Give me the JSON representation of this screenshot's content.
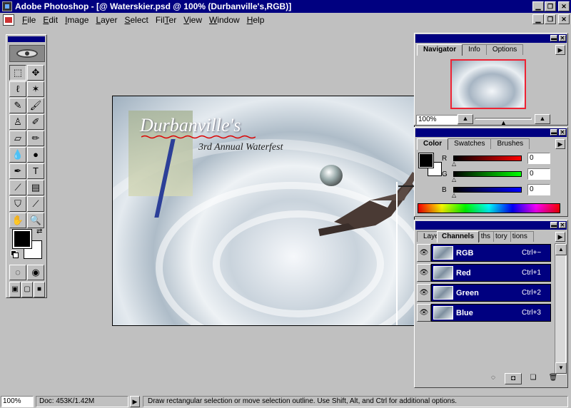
{
  "window": {
    "title": "Adobe Photoshop - [@ Waterskier.psd @ 100% (Durbanville's,RGB)]",
    "min_label": "▁",
    "max_label": "❐",
    "close_label": "✕"
  },
  "menu": {
    "items": [
      "File",
      "Edit",
      "Image",
      "Layer",
      "Select",
      "Filter",
      "View",
      "Window",
      "Help"
    ],
    "underline": [
      "F",
      "E",
      "I",
      "L",
      "S",
      "T",
      "V",
      "W",
      "H"
    ]
  },
  "tools": {
    "rows": [
      [
        {
          "name": "marquee-tool-icon",
          "glyph": "⬚",
          "pressed": true
        },
        {
          "name": "move-tool-icon",
          "glyph": "✥",
          "pressed": false
        }
      ],
      [
        {
          "name": "lasso-tool-icon",
          "glyph": "ℓ",
          "pressed": false
        },
        {
          "name": "magic-wand-tool-icon",
          "glyph": "✶",
          "pressed": false
        }
      ],
      [
        {
          "name": "airbrush-tool-icon",
          "glyph": "✎",
          "pressed": false
        },
        {
          "name": "paintbrush-tool-icon",
          "glyph": "🖌",
          "pressed": false
        }
      ],
      [
        {
          "name": "rubber-stamp-tool-icon",
          "glyph": "♙",
          "pressed": false
        },
        {
          "name": "history-brush-tool-icon",
          "glyph": "✐",
          "pressed": false
        }
      ],
      [
        {
          "name": "eraser-tool-icon",
          "glyph": "▱",
          "pressed": false
        },
        {
          "name": "pencil-tool-icon",
          "glyph": "✏",
          "pressed": false
        }
      ],
      [
        {
          "name": "blur-tool-icon",
          "glyph": "💧",
          "pressed": false
        },
        {
          "name": "burn-tool-icon",
          "glyph": "●",
          "pressed": false
        }
      ],
      [
        {
          "name": "pen-tool-icon",
          "glyph": "✒",
          "pressed": false
        },
        {
          "name": "type-tool-icon",
          "glyph": "T",
          "pressed": false
        }
      ],
      [
        {
          "name": "measure-tool-icon",
          "glyph": "⟋",
          "pressed": false
        },
        {
          "name": "gradient-tool-icon",
          "glyph": "▤",
          "pressed": false
        }
      ],
      [
        {
          "name": "paint-bucket-tool-icon",
          "glyph": "⛉",
          "pressed": false
        },
        {
          "name": "eyedropper-tool-icon",
          "glyph": "⟋",
          "pressed": false
        }
      ],
      [
        {
          "name": "hand-tool-icon",
          "glyph": "✋",
          "pressed": false
        },
        {
          "name": "zoom-tool-icon",
          "glyph": "🔍",
          "pressed": false
        }
      ]
    ]
  },
  "canvas": {
    "headline": "Durbanville's",
    "subhead": "3rd Annual Waterfest"
  },
  "navigator": {
    "tabs": [
      "Navigator",
      "Info",
      "Options"
    ],
    "zoom": "100%"
  },
  "color": {
    "tabs": [
      "Color",
      "Swatches",
      "Brushes"
    ],
    "channels": [
      {
        "label": "R",
        "value": "0",
        "gradient_to": "#ff0000"
      },
      {
        "label": "G",
        "value": "0",
        "gradient_to": "#00ff00"
      },
      {
        "label": "B",
        "value": "0",
        "gradient_to": "#0000ff"
      }
    ]
  },
  "channels": {
    "tabs": [
      "Layers",
      "Channels",
      "Paths",
      "History",
      "Actions"
    ],
    "tab_visible": [
      "Laye",
      "Channels",
      "ths",
      "tory",
      "tions"
    ],
    "rows": [
      {
        "name": "RGB",
        "shortcut": "Ctrl+~"
      },
      {
        "name": "Red",
        "shortcut": "Ctrl+1"
      },
      {
        "name": "Green",
        "shortcut": "Ctrl+2"
      },
      {
        "name": "Blue",
        "shortcut": "Ctrl+3"
      }
    ]
  },
  "status": {
    "zoom": "100%",
    "doc": "Doc: 453K/1.42M",
    "message": "Draw rectangular selection or move selection outline.  Use Shift, Alt, and Ctrl for additional options."
  },
  "colors": {
    "titlebar": "#000080",
    "face": "#c0c0c0",
    "selection": "#000080",
    "nav_frame": "#ee2233"
  }
}
